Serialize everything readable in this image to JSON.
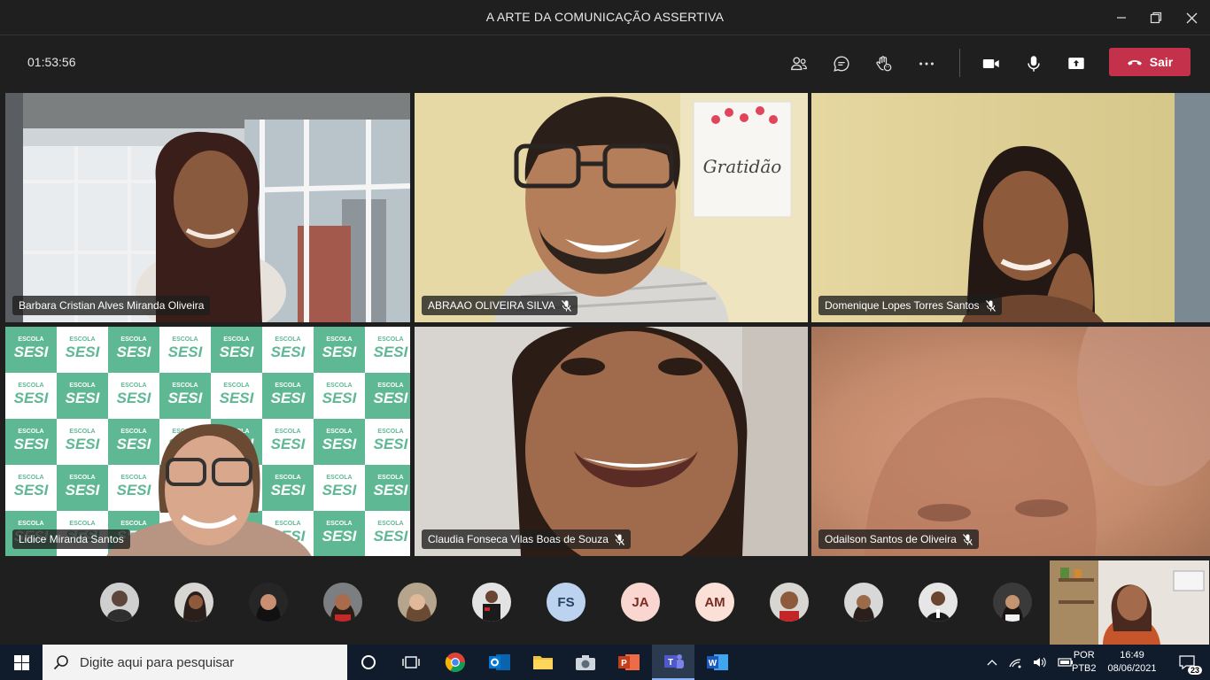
{
  "window": {
    "title": "A ARTE DA COMUNICAÇÃO ASSERTIVA"
  },
  "call": {
    "timer": "01:53:56",
    "leave_label": "Sair"
  },
  "participants": [
    {
      "name": "Barbara Cristian Alves Miranda Oliveira",
      "muted": false
    },
    {
      "name": "ABRAAO OLIVEIRA SILVA",
      "muted": true
    },
    {
      "name": "Domenique Lopes Torres Santos",
      "muted": true
    },
    {
      "name": "Lidice Miranda Santos",
      "muted": false
    },
    {
      "name": "Claudia Fonseca Vilas Boas de Souza",
      "muted": true
    },
    {
      "name": "Odailson Santos de Oliveira",
      "muted": true
    }
  ],
  "background_text": {
    "poster": "Gratidão",
    "brand": "SESI",
    "brand_top": "ESCOLA"
  },
  "strip": {
    "initials": [
      "FS",
      "JA",
      "AM"
    ]
  },
  "taskbar": {
    "search_placeholder": "Digite aqui para pesquisar",
    "lang_top": "POR",
    "lang_bottom": "PTB2",
    "time": "16:49",
    "date": "08/06/2021",
    "notifications": "23"
  },
  "colors": {
    "leave": "#c4314b",
    "taskbar": "#101c2c",
    "sesi_green": "#5fb894"
  }
}
